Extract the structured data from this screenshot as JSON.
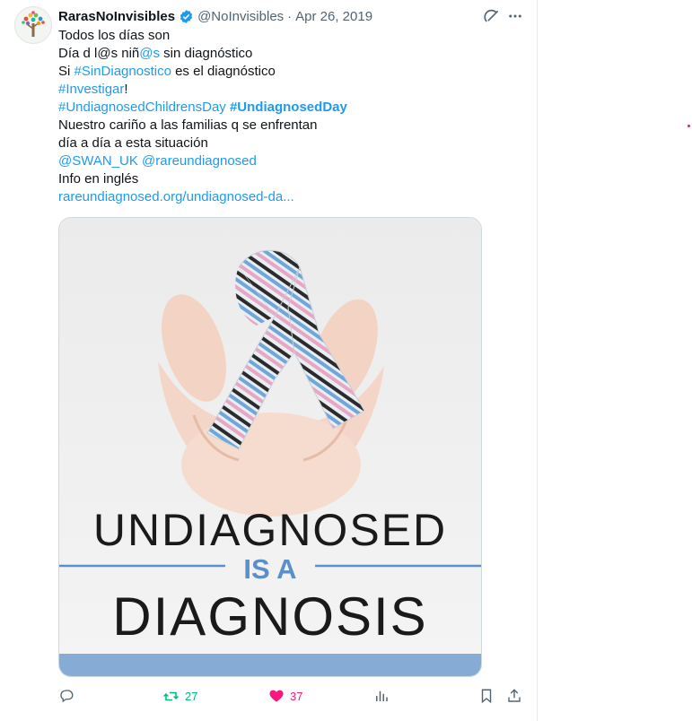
{
  "author": {
    "name": "RarasNoInvisibles",
    "handle": "@NoInvisibles",
    "separator": "·",
    "date": "Apr 26, 2019",
    "verified": true
  },
  "tweet": {
    "lines": [
      [
        "Todos los días son"
      ],
      [
        "Día d l@s niñ",
        "@s",
        " sin diagnóstico"
      ],
      [
        "Si ",
        "#SinDiagnostico",
        " es el diagnóstico"
      ],
      [
        "#Investigar",
        "!"
      ],
      [
        "#UndiagnosedChildrensDay",
        " ",
        "#UndiagnosedDay"
      ],
      [
        "Nuestro cariño a las familias q se enfrentan"
      ],
      [
        "día a día a esta situación"
      ],
      [
        "@SWAN_UK",
        " ",
        "@rareundiagnosed"
      ],
      [
        "Info en inglés"
      ],
      [
        "rareundiagnosed.org/undiagnosed-da..."
      ]
    ]
  },
  "image": {
    "line1": "UNDIAGNOSED",
    "line2": "IS A",
    "line3": "DIAGNOSIS"
  },
  "actions": {
    "reply_count": "",
    "retweet_count": "27",
    "like_count": "37"
  },
  "icons": [
    "verified-badge-icon",
    "grok-icon",
    "more-icon",
    "reply-icon",
    "retweet-icon",
    "heart-icon",
    "views-icon",
    "bookmark-icon",
    "share-icon"
  ],
  "colors": {
    "link": "#1d9bf0",
    "retweet": "#00ba7c",
    "like": "#f91880",
    "muted": "#536471",
    "image_blue": "#5b8fc9"
  }
}
